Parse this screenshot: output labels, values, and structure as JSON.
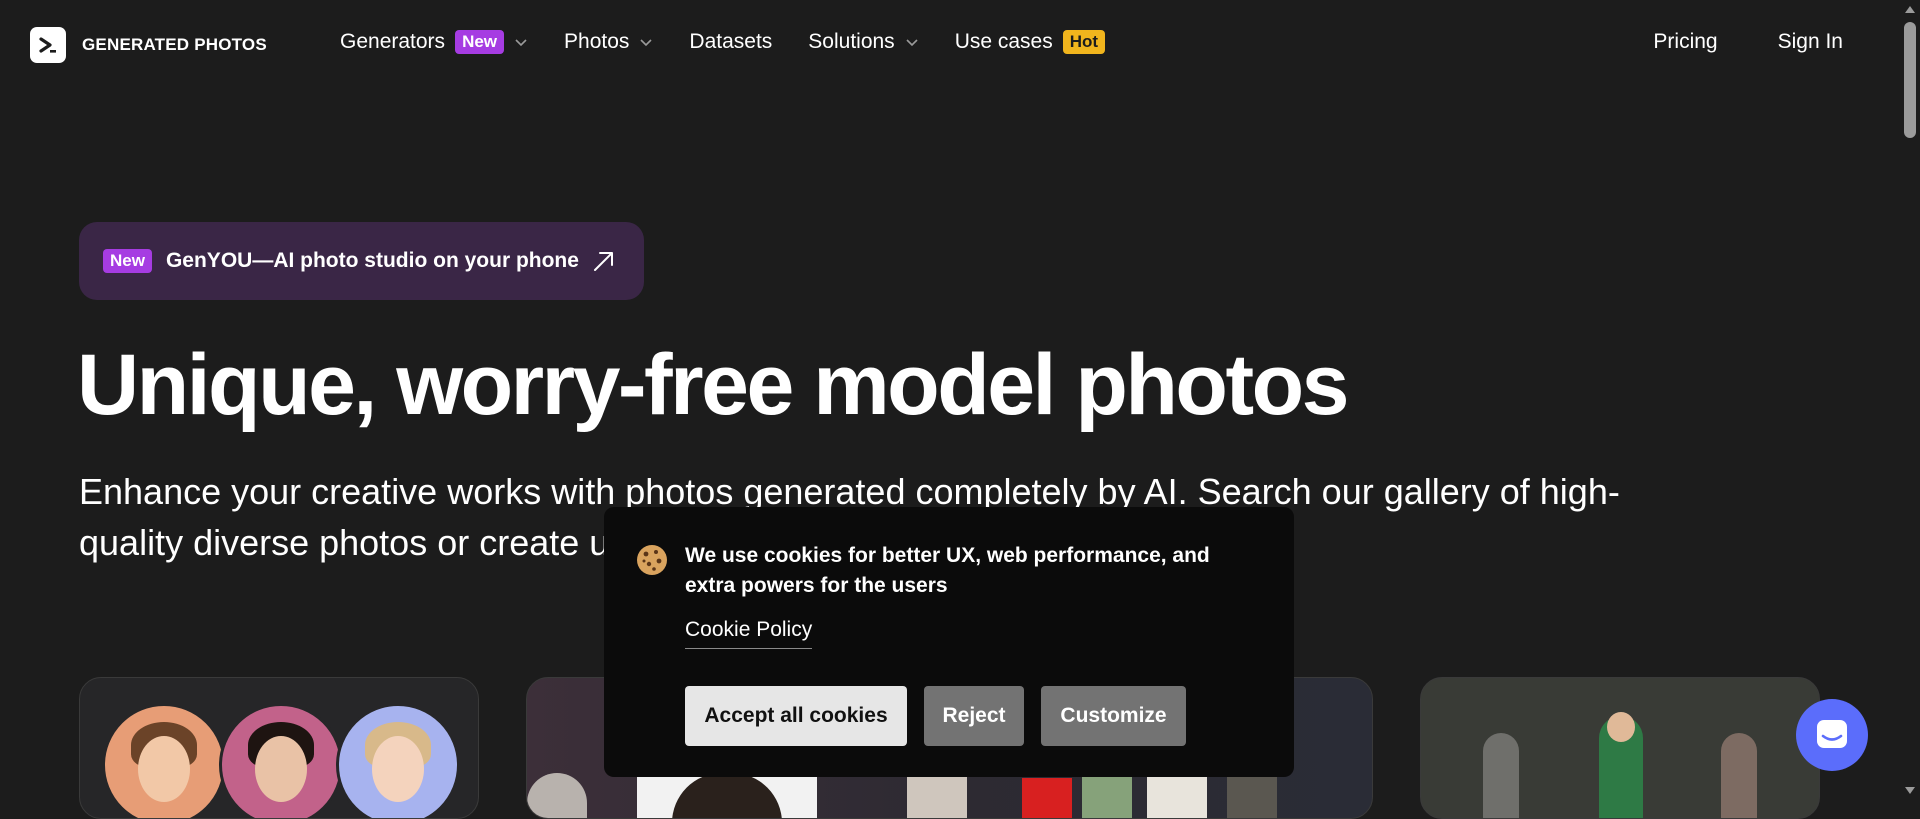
{
  "header": {
    "logo_text": "GENERATED PHOTOS",
    "nav": {
      "generators": "Generators",
      "generators_badge": "New",
      "photos": "Photos",
      "datasets": "Datasets",
      "solutions": "Solutions",
      "use_cases": "Use cases",
      "use_cases_badge": "Hot"
    },
    "pricing": "Pricing",
    "sign_in": "Sign In"
  },
  "promo": {
    "badge": "New",
    "text": "GenYOU—AI photo studio on your phone"
  },
  "hero": {
    "title": "Unique, worry-free model photos",
    "subtitle": "Enhance your creative works with photos generated completely by AI. Search our gallery of high-quality diverse photos or create unique models in real time"
  },
  "cookie_banner": {
    "message": "We use cookies for better UX, web performance, and extra powers for the users",
    "policy_link": "Cookie Policy",
    "accept": "Accept all cookies",
    "reject": "Reject",
    "customize": "Customize"
  },
  "colors": {
    "background": "#1c1c1c",
    "badge_new": "#a63ce2",
    "badge_hot": "#f1b51d",
    "promo_bg": "#3a2646",
    "chat_button": "#5b6dfb"
  },
  "icons": [
    "logo-chevron-icon",
    "chevron-down-icon",
    "arrow-up-right-icon",
    "cookie-icon",
    "chat-icon"
  ]
}
